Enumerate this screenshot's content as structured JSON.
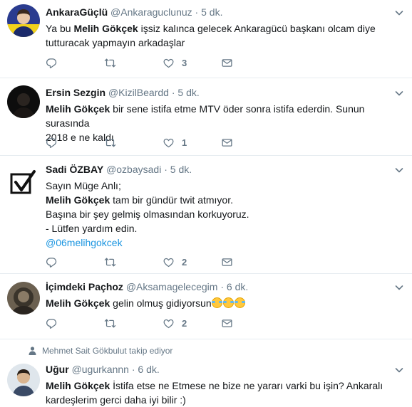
{
  "tweets": [
    {
      "name": "AnkaraGüçlü",
      "handle": "@Ankaraguclunuz",
      "time": "5 dk.",
      "lines": [
        {
          "prefix": "Ya bu ",
          "bold": "Melih Gökçek",
          "rest": " işsiz kalınca gelecek Ankaragücü başkanı olcam diye"
        },
        {
          "prefix": "tutturacak yapmayın arkadaşlar",
          "bold": "",
          "rest": ""
        }
      ],
      "likes": "3"
    },
    {
      "name": "Ersin Sezgin",
      "handle": "@KizilBeardd",
      "time": "5 dk.",
      "lines": [
        {
          "prefix": "",
          "bold": "Melih Gökçek",
          "rest": " bir sene istifa etme MTV öder sonra istifa ederdin. Sunun surasında"
        },
        {
          "prefix": "2018 e ne kaldı",
          "bold": "",
          "rest": ""
        }
      ],
      "likes": "1"
    },
    {
      "name": "Sadi ÖZBAY",
      "handle": "@ozbaysadi",
      "time": "5 dk.",
      "lines": [
        {
          "prefix": "Sayın Müge Anlı;",
          "bold": "",
          "rest": ""
        },
        {
          "prefix": "",
          "bold": "Melih Gökçek",
          "rest": " tam bir gündür twit atmıyor."
        },
        {
          "prefix": "Başına bir şey gelmiş olmasından korkuyoruz.",
          "bold": "",
          "rest": ""
        },
        {
          "prefix": "- Lütfen yardım edin.",
          "bold": "",
          "rest": ""
        }
      ],
      "mention": "@06melihgokcek",
      "likes": "2"
    },
    {
      "name": "İçimdeki Paçhoz",
      "handle": "@Aksamagelecegim",
      "time": "6 dk.",
      "lines": [
        {
          "prefix": "",
          "bold": "Melih Gökçek",
          "rest": " gelin olmuş gidiyorsun"
        }
      ],
      "likes": "2"
    },
    {
      "context": "Mehmet Sait Gökbulut takip ediyor",
      "name": "Uğur",
      "handle": "@ugurkannn",
      "time": "6 dk.",
      "lines": [
        {
          "prefix": "",
          "bold": "Melih Gökçek",
          "rest": " İstifa etse ne Etmese ne bize ne yararı varki bu işin? Ankaralı"
        },
        {
          "prefix": "kardeşlerim gerci daha iyi bilir :)",
          "bold": "",
          "rest": ""
        }
      ]
    }
  ],
  "separator": "·",
  "emoji": "face-with-tears-of-joy",
  "colors": {
    "link": "#1b95e0",
    "muted": "#657786",
    "border": "#e6ecf0"
  }
}
